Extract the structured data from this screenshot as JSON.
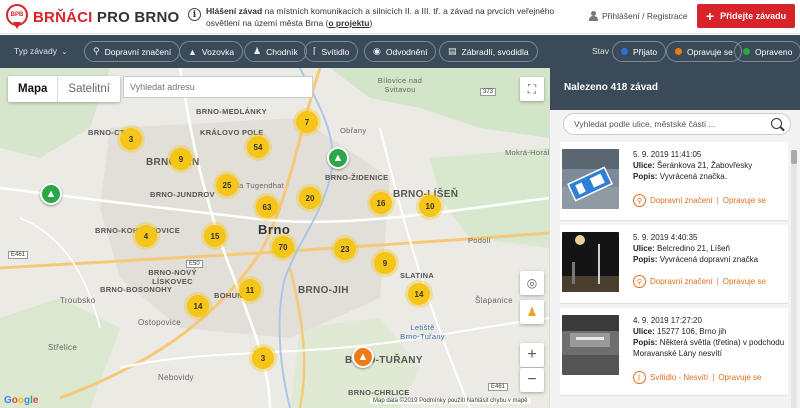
{
  "header": {
    "logo_badge": "BPB",
    "logo_part1": "BRŇÁCI",
    "logo_part2": "PRO BRNO",
    "info_bold": "Hlášení závad",
    "info_text": "na místních komunikacích a silnicích II. a III. tř. a závad na prvcích veřejného osvětlení na území města Brna",
    "info_link": "o projektu",
    "login_label": "Přihlášení / Registrace",
    "add_button_label": "Přidejte závadu"
  },
  "filters": {
    "type_label": "Typ závady",
    "chips": [
      {
        "label": "Dopravní značení",
        "icon": "sign-icon"
      },
      {
        "label": "Vozovka",
        "icon": "road-icon"
      },
      {
        "label": "Chodník",
        "icon": "pedestrian-icon"
      },
      {
        "label": "Svítidlo",
        "icon": "lamp-icon"
      },
      {
        "label": "Odvodnění",
        "icon": "drop-icon"
      },
      {
        "label": "Zábradlí, svodidla",
        "icon": "railing-icon"
      }
    ],
    "state_label": "Stav",
    "states": [
      {
        "label": "Přijato",
        "color": "#2f6fd6"
      },
      {
        "label": "Opravuje se",
        "color": "#f07a1a"
      },
      {
        "label": "Opraveno",
        "color": "#2aa845"
      }
    ]
  },
  "map": {
    "tab_map": "Mapa",
    "tab_satellite": "Satelitní",
    "address_placeholder": "Vyhledat adresu",
    "clusters": [
      "7",
      "3",
      "54",
      "9",
      "25",
      "20",
      "16",
      "10",
      "63",
      "4",
      "15",
      "70",
      "23",
      "9",
      "11",
      "14",
      "14",
      "3"
    ],
    "labels": {
      "brno_ctrc": "BRNO-CTRC",
      "kral_pole": "KRÁLOVO POLE",
      "medlanky": "BRNO-MEDLÁNKY",
      "bilovice": "Bílovice nad Svitavou",
      "obrany": "Obřany",
      "mokra": "Mokrá-Horákov",
      "brno_min": "BRNO-MÍN",
      "tugendhat": "Vila Tugendhat",
      "jundrov": "BRNO-JUNDROV",
      "zidenice": "BRNO-ŽIDENICE",
      "lisen": "BRNO-LÍŠEŇ",
      "kohoutovice": "BRNO-KOHOUTOVICE",
      "brno": "Brno",
      "podoli": "Podolí",
      "novy_liskovec": "BRNO-NOVÝ LÍSKOVEC",
      "bohunice": "BOHUNICE",
      "brno_jih": "BRNO-JIH",
      "slatina": "SLATINA",
      "bosonohy": "BRNO-BOSONOHY",
      "troubsko": "Troubsko",
      "ostopovice": "Ostopovice",
      "letiste": "Letiště Brno-Tuřany",
      "slapanice": "Šlapanice",
      "strelice": "Střelice",
      "turany": "BRNO-TUŘANY",
      "nebovidy": "Nebovidy",
      "chrlice": "BRNO-CHRLICE"
    },
    "attribution": "Map data ©2019   Podmínky použití   Nahlásit chybu v mapě",
    "google": "Google"
  },
  "sidebar": {
    "count_label": "Nalezeno 418 závad",
    "search_placeholder": "Vyhledat podle ulice, městské části ...",
    "items": [
      {
        "date": "5. 9. 2019 11:41:05",
        "street_label": "Ulice:",
        "street": "Šeránkova 21, Žabovřesky",
        "desc_label": "Popis:",
        "desc": "Vyvrácená značka.",
        "category": "Dopravní značení",
        "separator": "|",
        "status": "Opravuje se"
      },
      {
        "date": "5. 9. 2019 4:40:35",
        "street_label": "Ulice:",
        "street": "Belcredino 21, Líšeň",
        "desc_label": "Popis:",
        "desc": "Vyvrácená dopravní značka",
        "category": "Dopravní značení",
        "separator": "|",
        "status": "Opravuje se"
      },
      {
        "date": "4. 9. 2019 17:27:20",
        "street_label": "Ulice:",
        "street": "15277 106, Brno jih",
        "desc_label": "Popis:",
        "desc": "Některá světla (třetina) v podchodu Moravanské Lány nesvítí",
        "category": "Svítidlo - Nesvítí",
        "separator": "|",
        "status": "Opravuje se"
      }
    ]
  },
  "colors": {
    "brand_red": "#d8232a",
    "filterbar": "#3b4a58",
    "cluster": "#f5c518",
    "status_orange": "#e07020"
  }
}
